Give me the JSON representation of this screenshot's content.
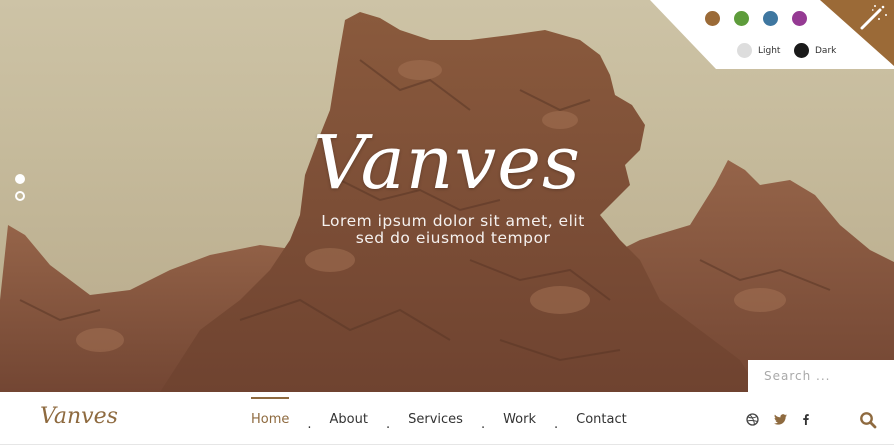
{
  "hero": {
    "title": "Vanves",
    "subtitle_line1": "Lorem ipsum dolor sit amet, elit",
    "subtitle_line2": "sed do eiusmod tempor"
  },
  "slider": {
    "dots": [
      "active",
      "inactive"
    ]
  },
  "style_switcher": {
    "colors": [
      "#9b6a37",
      "#5e9c3b",
      "#3f77a0",
      "#953a93"
    ],
    "light_label": "Light",
    "dark_label": "Dark",
    "light_color": "#dddddd",
    "dark_color": "#1a1a1a",
    "accent": "#9b6a37",
    "toggle_icon": "magic-wand-icon"
  },
  "search": {
    "placeholder": "Search ..."
  },
  "navbar": {
    "brand": "Vanves",
    "items": [
      {
        "label": "Home",
        "active": true
      },
      {
        "label": "About",
        "active": false
      },
      {
        "label": "Services",
        "active": false
      },
      {
        "label": "Work",
        "active": false
      },
      {
        "label": "Contact",
        "active": false
      }
    ],
    "separator": ".",
    "social_icons": [
      "dribbble-icon",
      "twitter-icon",
      "facebook-icon"
    ],
    "search_icon": "search-icon",
    "accent": "#8e6a3f"
  }
}
